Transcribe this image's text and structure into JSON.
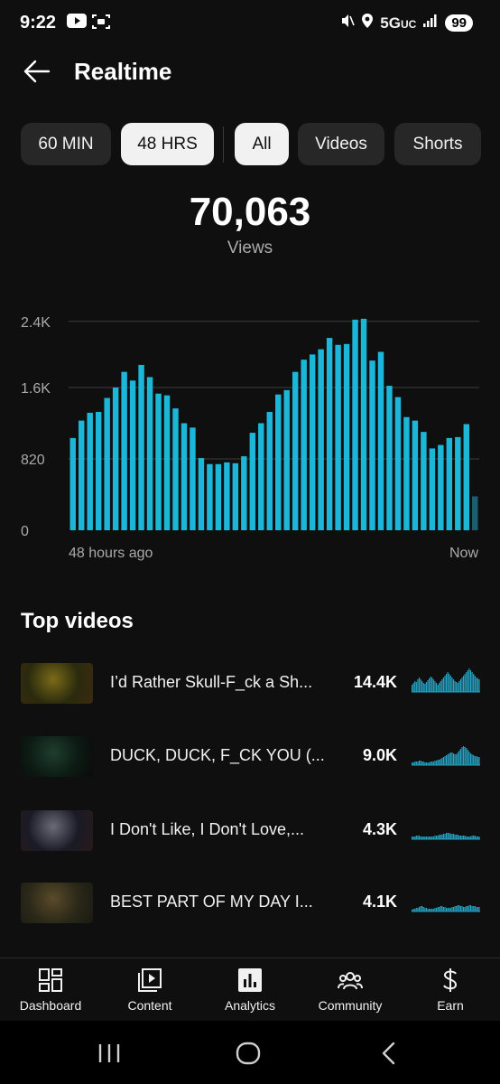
{
  "status_bar": {
    "time": "9:22",
    "network": "5G",
    "network_suffix": "UC",
    "battery": "99",
    "icons": [
      "youtube-icon",
      "screenshot-icon",
      "mute-icon",
      "location-icon",
      "signal-icon"
    ]
  },
  "header": {
    "title": "Realtime",
    "back_icon": "arrow-left-icon"
  },
  "filters": {
    "time_chips": [
      {
        "label": "60 MIN",
        "selected": false
      },
      {
        "label": "48 HRS",
        "selected": true
      }
    ],
    "type_chips": [
      {
        "label": "All",
        "selected": true
      },
      {
        "label": "Videos",
        "selected": false
      },
      {
        "label": "Shorts",
        "selected": false
      }
    ]
  },
  "metric": {
    "value": "70,063",
    "label": "Views"
  },
  "chart_data": {
    "type": "bar",
    "title": "",
    "xlabel": "",
    "ylabel": "",
    "ylim": [
      0,
      2460
    ],
    "y_ticks": [
      "2.4K",
      "1.6K",
      "820",
      "0"
    ],
    "y_tick_values": [
      2400,
      1640,
      820,
      0
    ],
    "x_start_label": "48 hours ago",
    "x_end_label": "Now",
    "color": "#1cb6d8",
    "current_hour_color": "#1a5e70",
    "values": [
      1060,
      1260,
      1350,
      1360,
      1520,
      1640,
      1820,
      1720,
      1900,
      1760,
      1570,
      1550,
      1400,
      1230,
      1180,
      830,
      760,
      760,
      780,
      770,
      850,
      1120,
      1230,
      1360,
      1560,
      1610,
      1820,
      1960,
      2020,
      2080,
      2210,
      2130,
      2140,
      2420,
      2430,
      1950,
      2050,
      1660,
      1530,
      1300,
      1260,
      1130,
      940,
      980,
      1060,
      1070,
      1220,
      390
    ]
  },
  "top_videos": {
    "title": "Top videos",
    "items": [
      {
        "title": "I’d Rather Skull-F_ck a Sh...",
        "views": "14.4K",
        "thumb_colors": [
          "#2a2a0e",
          "#7a6a18",
          "#3c2a10"
        ],
        "spark": [
          8,
          10,
          12,
          11,
          14,
          16,
          14,
          12,
          10,
          9,
          11,
          13,
          15,
          17,
          16,
          14,
          12,
          10,
          8,
          10,
          12,
          14,
          16,
          18,
          20,
          22,
          20,
          18,
          16,
          14,
          12,
          11,
          10,
          12,
          14,
          16,
          18,
          20,
          22,
          24,
          26,
          24,
          22,
          20,
          18,
          16,
          15,
          14
        ]
      },
      {
        "title": "DUCK, DUCK, F_CK YOU (...",
        "views": "9.0K",
        "thumb_colors": [
          "#0c1a14",
          "#1e3e2c",
          "#0a0a0a"
        ],
        "spark": [
          3,
          3,
          4,
          4,
          4,
          5,
          5,
          4,
          4,
          3,
          3,
          3,
          3,
          4,
          4,
          4,
          5,
          5,
          6,
          6,
          7,
          8,
          9,
          10,
          11,
          12,
          13,
          14,
          14,
          13,
          12,
          12,
          14,
          16,
          18,
          20,
          21,
          20,
          19,
          17,
          15,
          13,
          12,
          11,
          10,
          10,
          9,
          9
        ]
      },
      {
        "title": "I Don't Like, I Don't Love,...",
        "views": "4.3K",
        "thumb_colors": [
          "#1a1a26",
          "#6a6a78",
          "#2a1a1a"
        ],
        "spark": [
          3,
          3,
          3,
          4,
          4,
          4,
          3,
          3,
          3,
          3,
          3,
          3,
          3,
          3,
          3,
          3,
          4,
          4,
          4,
          5,
          5,
          5,
          6,
          6,
          7,
          7,
          7,
          6,
          6,
          6,
          5,
          5,
          5,
          4,
          4,
          4,
          4,
          4,
          3,
          3,
          3,
          3,
          4,
          4,
          4,
          3,
          3,
          3
        ]
      },
      {
        "title": "BEST PART OF MY DAY I...",
        "views": "4.1K",
        "thumb_colors": [
          "#2a2818",
          "#5a4a2a",
          "#1a1a12"
        ],
        "spark": [
          2,
          3,
          3,
          4,
          4,
          5,
          6,
          6,
          5,
          4,
          4,
          3,
          3,
          3,
          3,
          3,
          4,
          4,
          5,
          5,
          6,
          6,
          5,
          5,
          4,
          4,
          4,
          4,
          5,
          5,
          6,
          6,
          7,
          7,
          6,
          6,
          5,
          5,
          6,
          6,
          7,
          7,
          6,
          6,
          6,
          5,
          5,
          5
        ]
      }
    ]
  },
  "bottom_nav": [
    {
      "label": "Dashboard",
      "icon": "dashboard-icon"
    },
    {
      "label": "Content",
      "icon": "content-icon"
    },
    {
      "label": "Analytics",
      "icon": "analytics-icon",
      "selected": true
    },
    {
      "label": "Community",
      "icon": "community-icon"
    },
    {
      "label": "Earn",
      "icon": "earn-icon"
    }
  ],
  "system_nav": [
    "recents-icon",
    "home-icon",
    "back-icon"
  ]
}
